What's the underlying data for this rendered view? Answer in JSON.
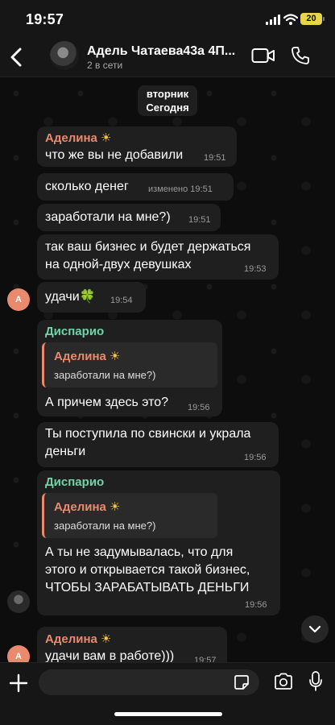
{
  "status": {
    "time": "19:57",
    "battery": "20"
  },
  "header": {
    "name": "Адель Чатаева43а  4П...",
    "subtitle": "2 в сети"
  },
  "date_pill": {
    "line1": "вторник",
    "line2": "Сегодня"
  },
  "messages": [
    {
      "sender": "Аделина",
      "text": "что же вы не добавили",
      "time": "19:51"
    },
    {
      "text": "сколько денег",
      "time": "изменено 19:51"
    },
    {
      "text": "заработали на мне?)",
      "time": "19:51"
    },
    {
      "text_lines": [
        "так ваш бизнес и будет держаться",
        "на одной-двух девушках"
      ],
      "time": "19:53"
    },
    {
      "text": "удачи🍀",
      "time": "19:54",
      "avatar": "A"
    },
    {
      "sender": "Диспарио",
      "quote_name": "Аделина",
      "quote_text": "заработали на мне?)",
      "text": "А причем здесь это?",
      "time": "19:56"
    },
    {
      "text_lines": [
        "Ты поступила по свински и украла",
        "деньги"
      ],
      "time": "19:56"
    },
    {
      "sender": "Диспарио",
      "quote_name": "Аделина",
      "quote_text": "заработали на мне?)",
      "text_lines": [
        "А ты не задумывалась, что для",
        "этого и открывается такой бизнес,",
        "ЧТОБЫ ЗАРАБАТЫВАТЬ ДЕНЬГИ"
      ],
      "time": "19:56"
    },
    {
      "sender": "Аделина",
      "text": "удачи вам в работе)))",
      "time": "19:57",
      "avatar": "A"
    }
  ],
  "colors": {
    "bubble": "#1f1f1f",
    "adelina": "#e98a6e",
    "disparios": "#6fd3a8",
    "sun": "#f5c542"
  },
  "composer": {
    "placeholder": ""
  }
}
